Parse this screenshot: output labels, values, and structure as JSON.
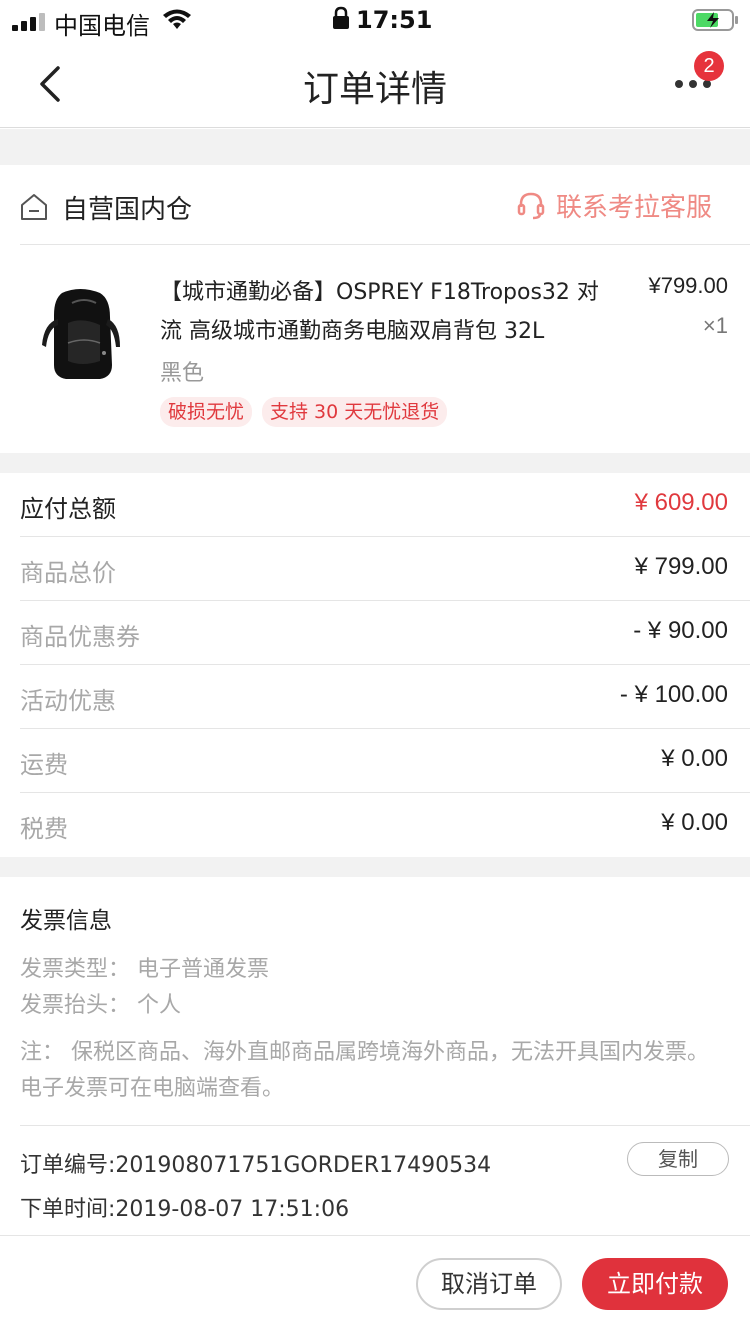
{
  "status_bar": {
    "carrier": "中国电信",
    "time": "17:51",
    "icons": [
      "signal-icon",
      "wifi-icon",
      "lock-icon",
      "battery-charging-icon"
    ]
  },
  "nav": {
    "title": "订单详情",
    "back_icon": "chevron-left-icon",
    "more_icon": "more-dots-icon",
    "badge_count": "2"
  },
  "warehouse": {
    "icon": "warehouse-icon",
    "label": "自营国内仓",
    "customer_service_icon": "headset-icon",
    "customer_service_label": "联系考拉客服",
    "accent_color": "#ef8a84"
  },
  "product": {
    "title": "【城市通勤必备】OSPREY F18Tropos32 对流 高级城市通勤商务电脑双肩背包 32L",
    "price": "¥799.00",
    "quantity": "×1",
    "color": "黑色",
    "tags": [
      "破损无忧",
      "支持 30 天无忧退货"
    ]
  },
  "price_summary": [
    {
      "label": "应付总额",
      "value": "¥ 609.00"
    },
    {
      "label": "商品总价",
      "value": "¥ 799.00"
    },
    {
      "label": "商品优惠券",
      "value": "- ¥ 90.00"
    },
    {
      "label": "活动优惠",
      "value": "- ¥ 100.00"
    },
    {
      "label": "运费",
      "value": "¥ 0.00"
    },
    {
      "label": "税费",
      "value": "¥ 0.00"
    }
  ],
  "invoice": {
    "title": "发票信息",
    "type": "发票类型：  电子普通发票",
    "header": "发票抬头：  个人",
    "note": "注：  保税区商品、海外直邮商品属跨境海外商品，无法开具国内发票。电子发票可在电脑端查看。"
  },
  "order": {
    "number": "订单编号:201908071751GORDER17490534",
    "copy_label": "复制",
    "time": "下单时间:2019-08-07 17:51:06"
  },
  "actions": {
    "cancel_label": "取消订单",
    "pay_label": "立即付款",
    "brand_color": "#e0323c"
  }
}
